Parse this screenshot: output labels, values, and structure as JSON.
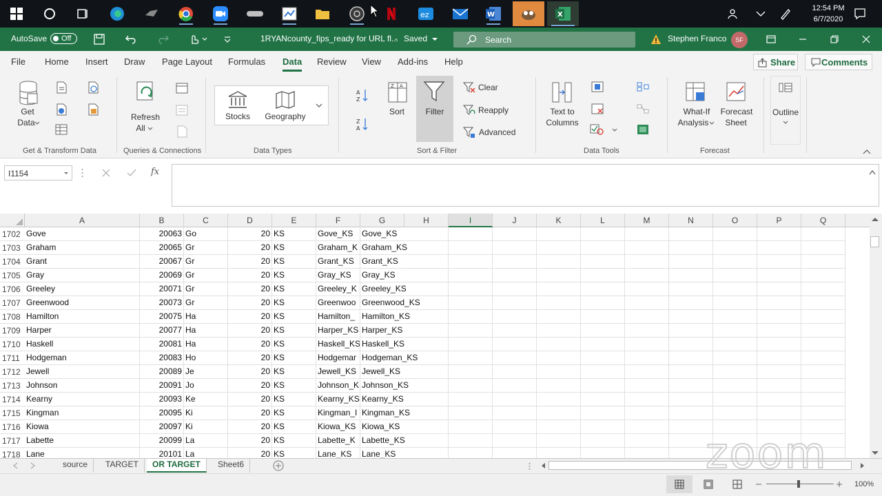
{
  "taskbar": {
    "icons": [
      "windows-start",
      "cortana",
      "task-view",
      "edge",
      "app-game",
      "chrome",
      "zoom",
      "app-device",
      "app-calendar",
      "file-explorer",
      "obs",
      "netflix",
      "eztalk",
      "mail",
      "word",
      "gimp",
      "excel"
    ],
    "clock_time": "12:54 PM",
    "clock_date": "6/7/2020"
  },
  "titlebar": {
    "autosave_label": "AutoSave",
    "autosave_state": "Off",
    "file_title": "1RYANcounty_fips_ready for URL fl...",
    "saved_status": "Saved",
    "search_placeholder": "Search",
    "user_name": "Stephen Franco",
    "user_initials": "SF"
  },
  "ribbon_tabs": [
    "File",
    "Home",
    "Insert",
    "Draw",
    "Page Layout",
    "Formulas",
    "Data",
    "Review",
    "View",
    "Add-ins",
    "Help"
  ],
  "active_tab": "Data",
  "share_label": "Share",
  "comments_label": "Comments",
  "ribbon": {
    "get_data": "Get",
    "get_data2": "Data",
    "refresh": "Refresh",
    "refresh2": "All",
    "stocks": "Stocks",
    "geography": "Geography",
    "sort": "Sort",
    "filter": "Filter",
    "clear": "Clear",
    "reapply": "Reapply",
    "advanced": "Advanced",
    "text_to": "Text to",
    "columns": "Columns",
    "what_if": "What-If",
    "analysis": "Analysis",
    "forecast": "Forecast",
    "sheet": "Sheet",
    "outline": "Outline",
    "groups": {
      "get_transform": "Get & Transform Data",
      "queries": "Queries & Connections",
      "data_types": "Data Types",
      "sort_filter": "Sort & Filter",
      "data_tools": "Data Tools",
      "forecast": "Forecast"
    }
  },
  "formula_bar": {
    "name_box": "I1154",
    "fx": "fx",
    "value": ""
  },
  "columns": [
    "A",
    "B",
    "C",
    "D",
    "E",
    "F",
    "G",
    "H",
    "I",
    "J",
    "K",
    "L",
    "M",
    "N",
    "O",
    "P",
    "Q"
  ],
  "selected_column": "I",
  "rows": [
    {
      "n": "1702",
      "a": "Gove",
      "b": "20063",
      "c": "Go",
      "d": "20",
      "e": "KS",
      "f": "Gove_KS",
      "g": "Gove_KS"
    },
    {
      "n": "1703",
      "a": "Graham",
      "b": "20065",
      "c": "Gr",
      "d": "20",
      "e": "KS",
      "f": "Graham_K",
      "g": "Graham_KS"
    },
    {
      "n": "1704",
      "a": "Grant",
      "b": "20067",
      "c": "Gr",
      "d": "20",
      "e": "KS",
      "f": "Grant_KS",
      "g": "Grant_KS"
    },
    {
      "n": "1705",
      "a": "Gray",
      "b": "20069",
      "c": "Gr",
      "d": "20",
      "e": "KS",
      "f": "Gray_KS",
      "g": "Gray_KS"
    },
    {
      "n": "1706",
      "a": "Greeley",
      "b": "20071",
      "c": "Gr",
      "d": "20",
      "e": "KS",
      "f": "Greeley_K",
      "g": "Greeley_KS"
    },
    {
      "n": "1707",
      "a": "Greenwood",
      "b": "20073",
      "c": "Gr",
      "d": "20",
      "e": "KS",
      "f": "Greenwoo",
      "g": "Greenwood_KS"
    },
    {
      "n": "1708",
      "a": "Hamilton",
      "b": "20075",
      "c": "Ha",
      "d": "20",
      "e": "KS",
      "f": "Hamilton_",
      "g": "Hamilton_KS"
    },
    {
      "n": "1709",
      "a": "Harper",
      "b": "20077",
      "c": "Ha",
      "d": "20",
      "e": "KS",
      "f": "Harper_KS",
      "g": "Harper_KS"
    },
    {
      "n": "1710",
      "a": "Haskell",
      "b": "20081",
      "c": "Ha",
      "d": "20",
      "e": "KS",
      "f": "Haskell_KS",
      "g": "Haskell_KS"
    },
    {
      "n": "1711",
      "a": "Hodgeman",
      "b": "20083",
      "c": "Ho",
      "d": "20",
      "e": "KS",
      "f": "Hodgemar",
      "g": "Hodgeman_KS"
    },
    {
      "n": "1712",
      "a": "Jewell",
      "b": "20089",
      "c": "Je",
      "d": "20",
      "e": "KS",
      "f": "Jewell_KS",
      "g": "Jewell_KS"
    },
    {
      "n": "1713",
      "a": "Johnson",
      "b": "20091",
      "c": "Jo",
      "d": "20",
      "e": "KS",
      "f": "Johnson_K",
      "g": "Johnson_KS"
    },
    {
      "n": "1714",
      "a": "Kearny",
      "b": "20093",
      "c": "Ke",
      "d": "20",
      "e": "KS",
      "f": "Kearny_KS",
      "g": "Kearny_KS"
    },
    {
      "n": "1715",
      "a": "Kingman",
      "b": "20095",
      "c": "Ki",
      "d": "20",
      "e": "KS",
      "f": "Kingman_I",
      "g": "Kingman_KS"
    },
    {
      "n": "1716",
      "a": "Kiowa",
      "b": "20097",
      "c": "Ki",
      "d": "20",
      "e": "KS",
      "f": "Kiowa_KS",
      "g": "Kiowa_KS"
    },
    {
      "n": "1717",
      "a": "Labette",
      "b": "20099",
      "c": "La",
      "d": "20",
      "e": "KS",
      "f": "Labette_K",
      "g": "Labette_KS"
    },
    {
      "n": "1718",
      "a": "Lane",
      "b": "20101",
      "c": "La",
      "d": "20",
      "e": "KS",
      "f": "Lane_KS",
      "g": "Lane_KS"
    }
  ],
  "sheet_tabs": [
    "source",
    "TARGET",
    "OR TARGET",
    "Sheet6"
  ],
  "active_sheet": "OR TARGET",
  "zoom_percent": "100%",
  "watermark": "zoom",
  "colors": {
    "excel_green": "#217346",
    "taskbar": "#101418"
  }
}
